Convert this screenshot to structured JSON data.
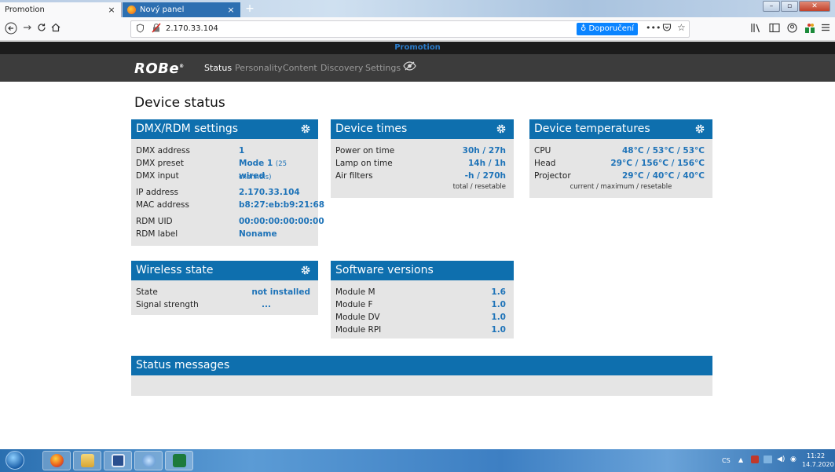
{
  "browser": {
    "tabs": [
      {
        "title": "Promotion",
        "close": "×"
      },
      {
        "title": "Nový panel",
        "close": "×"
      }
    ],
    "new_tab": "+",
    "window_controls": {
      "minimize": "–",
      "maximize": "▫",
      "close": "✕"
    },
    "url": "2.170.33.104",
    "recommend_label": "Doporučení",
    "nav_icons": [
      "back-arrow-icon",
      "forward-arrow-icon",
      "reload-icon",
      "home-icon"
    ],
    "toolbar_icons": [
      "library-icon",
      "sidebar-icon",
      "account-icon",
      "extensions-icon",
      "menu-icon"
    ]
  },
  "site": {
    "title": "Promotion",
    "logo": "ROBe",
    "nav": [
      "Status",
      "Personality",
      "Content",
      "Discovery",
      "Settings"
    ],
    "active_nav": "Status"
  },
  "page_title": "Device status",
  "dmx": {
    "title": "DMX/RDM settings",
    "rows": [
      {
        "label": "DMX address",
        "value": "1"
      },
      {
        "label": "DMX preset",
        "value": "Mode 1",
        "extra": "(25 channels)"
      },
      {
        "label": "DMX input",
        "value": "wired"
      },
      {
        "label": "IP address",
        "value": "2.170.33.104"
      },
      {
        "label": "MAC address",
        "value": "b8:27:eb:b9:21:68"
      },
      {
        "label": "RDM UID",
        "value": "00:00:00:00:00:00"
      },
      {
        "label": "RDM label",
        "value": "Noname"
      }
    ]
  },
  "times": {
    "title": "Device times",
    "rows": [
      {
        "label": "Power on time",
        "value": "30h / 27h"
      },
      {
        "label": "Lamp on time",
        "value": "14h / 1h"
      },
      {
        "label": "Air filters",
        "value": "-h / 270h"
      }
    ],
    "note": "total / resetable"
  },
  "temps": {
    "title": "Device temperatures",
    "rows": [
      {
        "label": "CPU",
        "value": "48°C / 53°C / 53°C"
      },
      {
        "label": "Head",
        "value": "29°C / 156°C / 156°C"
      },
      {
        "label": "Projector",
        "value": "29°C / 40°C / 40°C"
      }
    ],
    "note": "current / maximum / resetable"
  },
  "wireless": {
    "title": "Wireless state",
    "rows": [
      {
        "label": "State",
        "value": "not installed"
      },
      {
        "label": "Signal strength",
        "value": "..."
      }
    ]
  },
  "software": {
    "title": "Software versions",
    "rows": [
      {
        "label": "Module M",
        "value": "1.6"
      },
      {
        "label": "Module F",
        "value": "1.0"
      },
      {
        "label": "Module DV",
        "value": "1.0"
      },
      {
        "label": "Module RPI",
        "value": "1.0"
      }
    ]
  },
  "status_messages": {
    "title": "Status messages"
  },
  "taskbar": {
    "apps": [
      "firefox-icon",
      "explorer-icon",
      "save-icon",
      "media-player-icon",
      "excel-icon"
    ],
    "language": "CS",
    "time": "11:22",
    "date": "14.7.2020"
  },
  "colors": {
    "accent": "#0e6fae",
    "value": "#1e73b8",
    "panel": "#e5e5e5"
  }
}
